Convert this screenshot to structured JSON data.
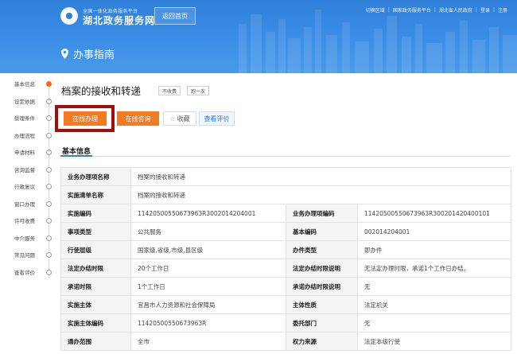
{
  "header": {
    "logo_sub": "全国一体化政务服务平台",
    "logo_main": "湖北政务服务网",
    "home_button": "返回首页",
    "top_links": [
      "切换区域",
      "国家政务服务平台",
      "湖北省人民政府",
      "登录",
      "注册"
    ],
    "guide_title": "办事指南"
  },
  "leftnav": {
    "items": [
      {
        "label": "基本信息",
        "active": true
      },
      {
        "label": "设定依据",
        "active": false
      },
      {
        "label": "受理条件",
        "active": false
      },
      {
        "label": "办理流程",
        "active": false
      },
      {
        "label": "申请材料",
        "active": false
      },
      {
        "label": "咨询监督",
        "active": false
      },
      {
        "label": "行政复议",
        "active": false
      },
      {
        "label": "窗口办理",
        "active": false
      },
      {
        "label": "许可收费",
        "active": false
      },
      {
        "label": "中介服务",
        "active": false
      },
      {
        "label": "常见问题",
        "active": false
      },
      {
        "label": "查看评价",
        "active": false
      }
    ]
  },
  "main": {
    "title": "档案的接收和转递",
    "tags": [
      "不收费",
      "跑一次"
    ],
    "buttons": {
      "online": "在线办理",
      "consult": "在线咨询",
      "favorite": "收藏",
      "rate": "查看评价"
    },
    "section_title": "基本信息",
    "table": {
      "full_rows": [
        {
          "label": "业务办理项名称",
          "value": "档案的接收和转递"
        },
        {
          "label": "实施清单名称",
          "value": "档案的接收和转递"
        }
      ],
      "rows": [
        {
          "l1": "实施编码",
          "v1": "11420500550673963R3002014204001",
          "l2": "业务办理项编码",
          "v2": "11420500550673963R300201420400101"
        },
        {
          "l1": "事项类型",
          "v1": "公共服务",
          "l2": "基本编码",
          "v2": "002014204001"
        },
        {
          "l1": "行使层级",
          "v1": "国家级,省级,市级,县区级",
          "l2": "办件类型",
          "v2": "即办件"
        },
        {
          "l1": "法定办结时限",
          "v1": "20个工作日",
          "l2": "法定办结时限说明",
          "v2": "无法定办理时限，承诺1个工作日办结。"
        },
        {
          "l1": "承诺时限",
          "v1": "1个工作日",
          "l2": "承诺办结时限说明",
          "v2": "无"
        },
        {
          "l1": "实施主体",
          "v1": "宜昌市人力资源和社会保障局",
          "l2": "主体性质",
          "v2": "法定机关"
        },
        {
          "l1": "实施主体编码",
          "v1": "11420500550673963R",
          "l2": "委托部门",
          "v2": "无"
        },
        {
          "l1": "通办范围",
          "v1": "全市",
          "l2": "权力来源",
          "v2": "法定本级行使"
        }
      ]
    }
  },
  "colors": {
    "header_blue": "#2f7fd8",
    "accent_orange": "#f57a22",
    "highlight_red": "#a10e0e"
  }
}
